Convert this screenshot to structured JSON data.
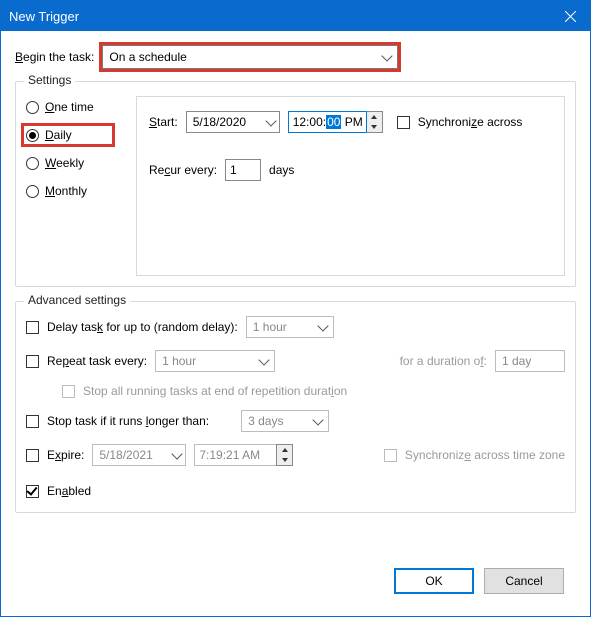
{
  "title": "New Trigger",
  "begin_label": "Begin the task:",
  "begin_value": "On a schedule",
  "settings_legend": "Settings",
  "frequency": {
    "one_time": "One time",
    "daily": "Daily",
    "weekly": "Weekly",
    "monthly": "Monthly",
    "selected": "daily"
  },
  "start_label": "Start:",
  "start_date": "5/18/2020",
  "start_time_h": "12",
  "start_time_m": "00",
  "start_time_s": "00",
  "start_time_ampm": "PM",
  "sync_label": "Synchronize across",
  "recur_label": "Recur every:",
  "recur_value": "1",
  "recur_unit": "days",
  "adv_legend": "Advanced settings",
  "delay_label": "Delay task for up to (random delay):",
  "delay_value": "1 hour",
  "repeat_label": "Repeat task every:",
  "repeat_value": "1 hour",
  "duration_label": "for a duration of:",
  "duration_value": "1 day",
  "stop_repetition_label": "Stop all running tasks at end of repetition duration",
  "stop_longer_label": "Stop task if it runs longer than:",
  "stop_longer_value": "3 days",
  "expire_label": "Expire:",
  "expire_date": "5/18/2021",
  "expire_time": "7:19:21 AM",
  "sync_tz_label": "Synchronize across time zone",
  "enabled_label": "Enabled",
  "ok_label": "OK",
  "cancel_label": "Cancel"
}
